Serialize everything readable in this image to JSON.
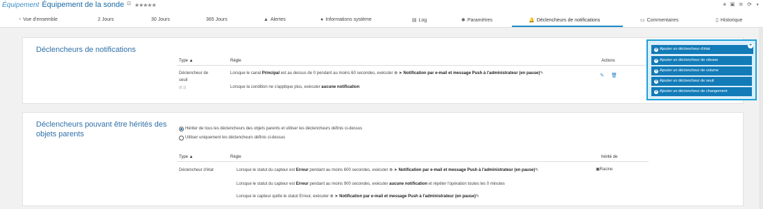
{
  "header": {
    "type_label": "Équipement",
    "title": "Équipement de la sonde",
    "small_icon": "⊡",
    "stars": "★★★★★",
    "window_icons": "⏸ ▣ ✉ ⟳ ▾"
  },
  "tabs": [
    {
      "icon": "◔",
      "label": "Vue d'ensemble"
    },
    {
      "icon": "",
      "label": "2  Jours"
    },
    {
      "icon": "",
      "label": "30 Jours"
    },
    {
      "icon": "",
      "label": "365 Jours"
    },
    {
      "icon": "▲",
      "label": "Alertes"
    },
    {
      "icon": "●",
      "label": "Informations système"
    },
    {
      "icon": "▤",
      "label": "Log"
    },
    {
      "icon": "✱",
      "label": "Paramètres"
    },
    {
      "icon": "🔔",
      "label": "Déclencheurs de notifications"
    },
    {
      "icon": "▭",
      "label": "Commentaires"
    },
    {
      "icon": "▯",
      "label": "Historique"
    }
  ],
  "panel1": {
    "title": "Déclencheurs de notifications",
    "headers": {
      "type": "Type ▲",
      "rule": "Règle",
      "actions": "Actions"
    },
    "row": {
      "type_l1": "Déclencheur de",
      "type_l2": "seuil",
      "type_id": "(0.1)",
      "rule1_a": "Lorsque le canal ",
      "rule1_b": "Principal",
      "rule1_c": " est au dessus de 0 pendant au moins 60 secondes, exécuter ",
      "rule1_d": "⊗ ➤ ",
      "rule1_e": "Notification par e-mail et message Push à l'administrateur (en pause)",
      "rule1_f": "✎",
      "rule2_a": "Lorsque la condition ne s'applique plus, exécuter ",
      "rule2_b": "aucune notification",
      "edit_icon": "✎",
      "delete_icon": "🗑"
    }
  },
  "dropdown": {
    "items": [
      "Ajouter un déclencheur d'état",
      "Ajouter un déclencheur de vitesse",
      "Ajouter un déclencheur de volume",
      "Ajouter un déclencheur de seuil",
      "Ajouter un déclencheur de changement"
    ],
    "plus": "+",
    "close": "+"
  },
  "panel2": {
    "title_l1": "Déclencheurs pouvant être hérités des",
    "title_l2": "objets parents",
    "radio1": "Hériter de tous les déclencheurs des objets parents et utiliser les déclencheurs définis ci-dessus",
    "radio2": "Utiliser uniquement les déclencheurs définis ci-dessus",
    "headers": {
      "type": "Type ▲",
      "rule": "Règle",
      "inherited": "hérité de"
    },
    "row": {
      "type": "Déclencheur d'état",
      "r1_a": "Lorsque le statut du capteur est ",
      "r1_b": "Erreur",
      "r1_c": " pendant au moins 600 secondes, exécuter ",
      "r1_d": "⊗ ➤ ",
      "r1_e": "Notification par e-mail et message Push à l'administrateur (en pause)",
      "r1_f": "✎",
      "r2_a": "Lorsque le statut du capteur est ",
      "r2_b": "Erreur",
      "r2_c": " pendant au moins 900 secondes, exécuter ",
      "r2_d": "aucune notification",
      "r2_e": " et répéter l'opération toutes les 0 minutes",
      "r3_a": "Lorsque le capteur quitte le statut Erreur, exécuter ",
      "r3_b": "⊗ ➤ ",
      "r3_c": "Notification par e-mail et message Push à l'administrateur (en pause)",
      "r3_d": "✎",
      "inherited_icon": "▣",
      "inherited_from": "Racine"
    }
  }
}
